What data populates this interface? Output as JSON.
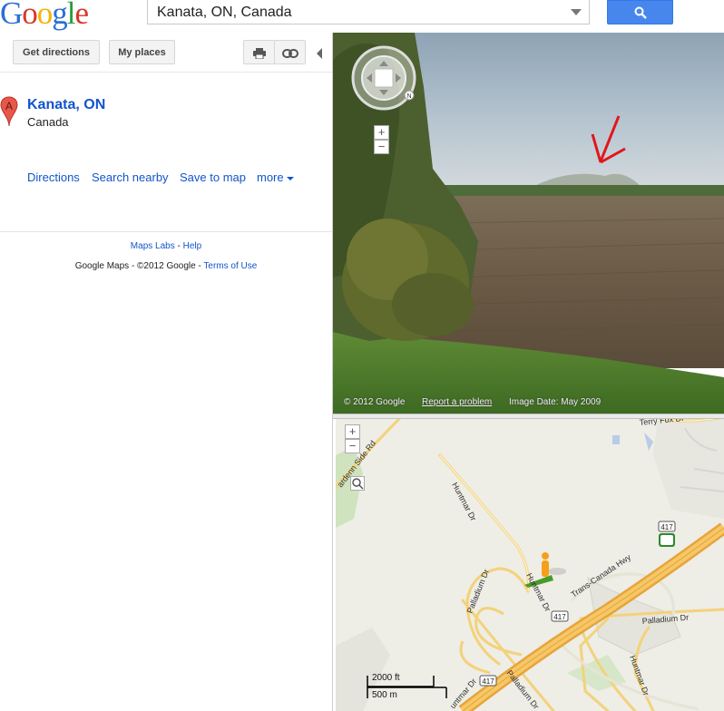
{
  "header": {
    "logo_letters": [
      "G",
      "o",
      "o",
      "g",
      "l",
      "e"
    ],
    "search_value": "Kanata, ON, Canada"
  },
  "left": {
    "buttons": {
      "directions": "Get directions",
      "my_places": "My places"
    },
    "place": {
      "marker": "A",
      "title": "Kanata, ON",
      "subtitle": "Canada"
    },
    "actions": {
      "directions": "Directions",
      "search_nearby": "Search nearby",
      "save_to_map": "Save to map",
      "more": "more"
    },
    "footer": {
      "maps_labs": "Maps Labs",
      "sep1": " - ",
      "help": "Help",
      "copyright": "Google Maps - ©2012 Google - ",
      "terms": "Terms of Use"
    }
  },
  "streetview": {
    "copyright": "© 2012 Google",
    "report": "Report a problem",
    "image_date": "Image Date: May 2009",
    "compass_n": "N"
  },
  "map": {
    "roads": {
      "terry_fox": "Terry Fox Dr",
      "side_rd": "ardenn Side Rd",
      "huntmar_top": "Huntmar Dr",
      "huntmar_mid": "Huntmar Dr",
      "trans_canada": "Trans-Canada Hwy",
      "palladium_left": "Palladium Dr",
      "palladium_right": "Palladium Dr",
      "huntmar_bottom": "Huntmar Dr",
      "palladium_bottom": "Palladium Dr",
      "huntmar_lower_left": "untmar Dr"
    },
    "shields": {
      "h1": "417",
      "h2": "417",
      "h3": "417"
    },
    "scale": {
      "feet": "2000 ft",
      "meters": "500 m"
    }
  }
}
